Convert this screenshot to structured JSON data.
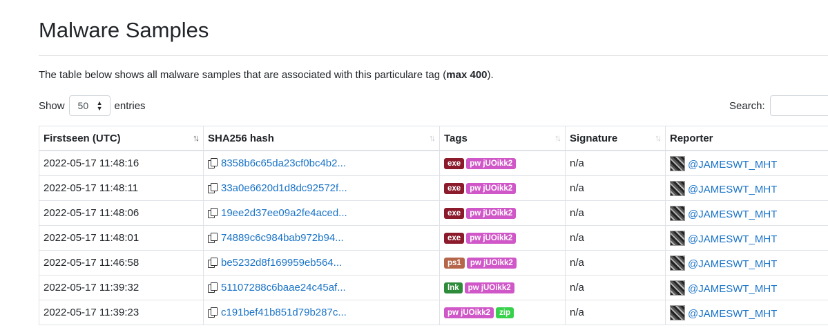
{
  "heading": "Malware Samples",
  "description": {
    "prefix": "The table below shows all malware samples that are associated with this particulare tag (",
    "bold": "max 400",
    "suffix": ")."
  },
  "length_menu": {
    "show": "Show",
    "value": "50",
    "entries": "entries"
  },
  "search": {
    "label": "Search:",
    "value": ""
  },
  "columns": [
    "Firstseen (UTC)",
    "SHA256 hash",
    "Tags",
    "Signature",
    "Reporter"
  ],
  "tag_colors": {
    "exe": "#8b1a2b",
    "pw jUOikk2": "#d057c7",
    "ps1": "#b5664a",
    "lnk": "#2e8b3a",
    "zip": "#37d14b"
  },
  "rows": [
    {
      "firstseen": "2022-05-17 11:48:16",
      "hash": "8358b6c65da23cf0bc4b2...",
      "tags": [
        "exe",
        "pw jUOikk2"
      ],
      "signature": "n/a",
      "reporter": "@JAMESWT_MHT"
    },
    {
      "firstseen": "2022-05-17 11:48:11",
      "hash": "33a0e6620d1d8dc92572f...",
      "tags": [
        "exe",
        "pw jUOikk2"
      ],
      "signature": "n/a",
      "reporter": "@JAMESWT_MHT"
    },
    {
      "firstseen": "2022-05-17 11:48:06",
      "hash": "19ee2d37ee09a2fe4aced...",
      "tags": [
        "exe",
        "pw jUOikk2"
      ],
      "signature": "n/a",
      "reporter": "@JAMESWT_MHT"
    },
    {
      "firstseen": "2022-05-17 11:48:01",
      "hash": "74889c6c984bab972b94...",
      "tags": [
        "exe",
        "pw jUOikk2"
      ],
      "signature": "n/a",
      "reporter": "@JAMESWT_MHT"
    },
    {
      "firstseen": "2022-05-17 11:46:58",
      "hash": "be5232d8f169959eb564...",
      "tags": [
        "ps1",
        "pw jUOikk2"
      ],
      "signature": "n/a",
      "reporter": "@JAMESWT_MHT"
    },
    {
      "firstseen": "2022-05-17 11:39:32",
      "hash": "51107288c6baae24c45af...",
      "tags": [
        "lnk",
        "pw jUOikk2"
      ],
      "signature": "n/a",
      "reporter": "@JAMESWT_MHT"
    },
    {
      "firstseen": "2022-05-17 11:39:23",
      "hash": "c191bef41b851d79b287c...",
      "tags": [
        "pw jUOikk2",
        "zip"
      ],
      "signature": "n/a",
      "reporter": "@JAMESWT_MHT"
    }
  ]
}
